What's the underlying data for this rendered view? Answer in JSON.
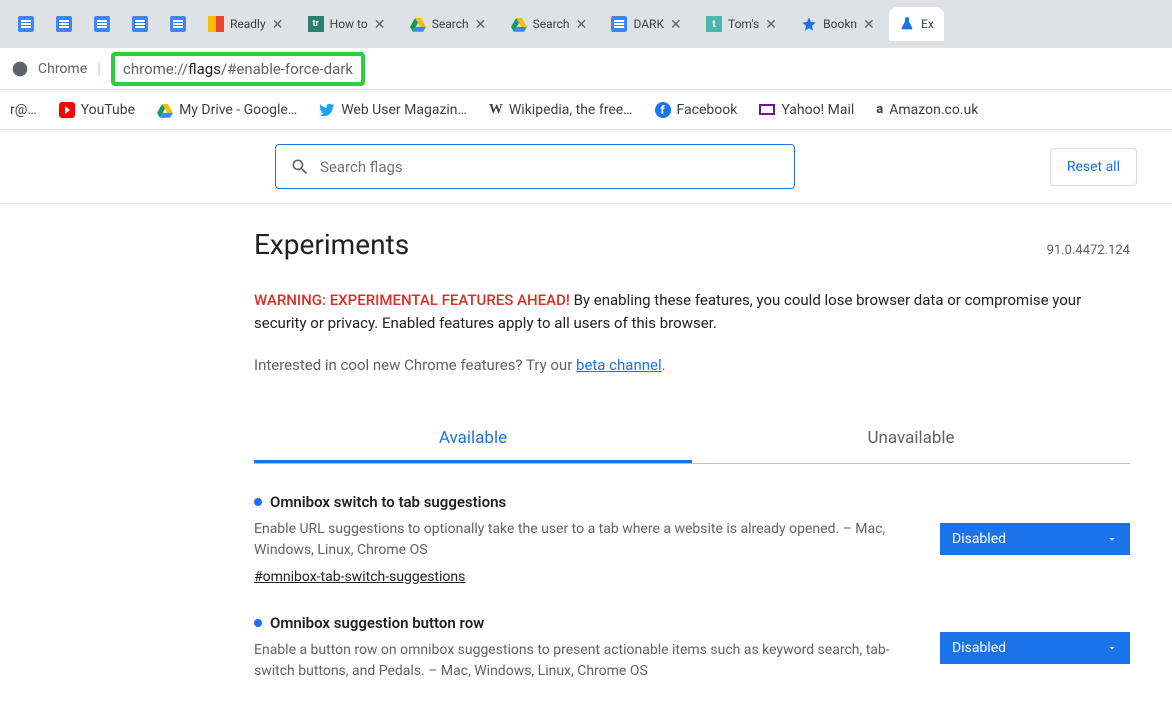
{
  "address": {
    "prefix": "chrome://",
    "host": "flags",
    "hash": "/#enable-force-dark",
    "chrome_label": "Chrome"
  },
  "tabs": [
    {
      "type": "doc"
    },
    {
      "type": "doc"
    },
    {
      "type": "doc"
    },
    {
      "type": "doc"
    },
    {
      "type": "doc"
    },
    {
      "type": "readvly",
      "label": "Readly",
      "closable": true
    },
    {
      "type": "tr",
      "label": "How to",
      "closable": true
    },
    {
      "type": "drive",
      "label": "Search",
      "closable": true
    },
    {
      "type": "drive",
      "label": "Search",
      "closable": true
    },
    {
      "type": "doc",
      "label": "DARK",
      "closable": true
    },
    {
      "type": "t",
      "label": "Tom's",
      "closable": true
    },
    {
      "type": "star",
      "label": "Bookn",
      "closable": true
    },
    {
      "type": "flask",
      "label": "Ex",
      "active": true
    }
  ],
  "bookmarks": [
    {
      "icon": "mail",
      "label": "r@…"
    },
    {
      "icon": "youtube",
      "label": "YouTube"
    },
    {
      "icon": "drive",
      "label": "My Drive - Google…"
    },
    {
      "icon": "twitter",
      "label": "Web User Magazin…"
    },
    {
      "icon": "wiki",
      "label": "Wikipedia, the free…"
    },
    {
      "icon": "facebook",
      "label": "Facebook"
    },
    {
      "icon": "yahoo",
      "label": "Yahoo! Mail"
    },
    {
      "icon": "amazon",
      "label": "Amazon.co.uk"
    }
  ],
  "search": {
    "placeholder": "Search flags"
  },
  "reset_label": "Reset all",
  "page_title": "Experiments",
  "version": "91.0.4472.124",
  "warning_bold": "WARNING: EXPERIMENTAL FEATURES AHEAD!",
  "warning_rest": " By enabling these features, you could lose browser data or compromise your security or privacy. Enabled features apply to all users of this browser.",
  "beta_prefix": "Interested in cool new Chrome features? Try our ",
  "beta_link": "beta channel",
  "tab_available": "Available",
  "tab_unavailable": "Unavailable",
  "flags": [
    {
      "title": "Omnibox switch to tab suggestions",
      "desc": "Enable URL suggestions to optionally take the user to a tab where a website is already opened. – Mac, Windows, Linux, Chrome OS",
      "hash": "#omnibox-tab-switch-suggestions",
      "value": "Disabled"
    },
    {
      "title": "Omnibox suggestion button row",
      "desc": "Enable a button row on omnibox suggestions to present actionable items such as keyword search, tab-switch buttons, and Pedals. – Mac, Windows, Linux, Chrome OS",
      "hash": "",
      "value": "Disabled"
    }
  ]
}
